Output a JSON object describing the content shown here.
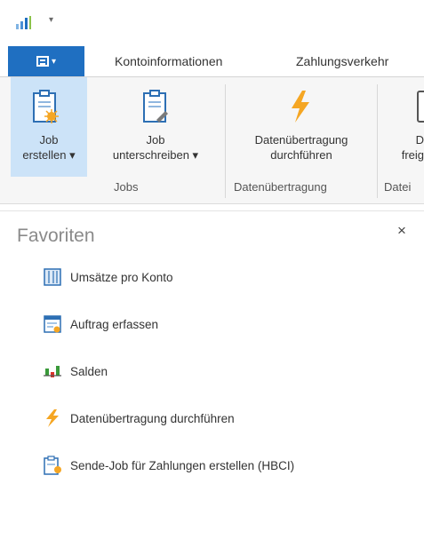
{
  "qat": {
    "dropdown_glyph": "▾"
  },
  "tabs": {
    "file_caret": "▾",
    "items": [
      {
        "label": "Kontoinformationen"
      },
      {
        "label": "Zahlungsverkehr"
      }
    ]
  },
  "ribbon": {
    "buttons": {
      "job_erstellen": {
        "line1": "Job",
        "line2": "erstellen ▾"
      },
      "job_unterschreiben": {
        "line1": "Job",
        "line2": "unterschreiben ▾"
      },
      "datenuebertragung": {
        "line1": "Datenübertragung",
        "line2": "durchführen"
      },
      "freigeben": {
        "line1": "D",
        "line2": "freig"
      }
    },
    "groups": {
      "jobs": "Jobs",
      "datenuebertragung": "Datenübertragung",
      "datei": "Datei"
    }
  },
  "panel": {
    "title": "Favoriten",
    "close_glyph": "×",
    "items": [
      {
        "label": "Umsätze pro Konto",
        "icon": "report-icon"
      },
      {
        "label": "Auftrag erfassen",
        "icon": "order-form-icon"
      },
      {
        "label": "Salden",
        "icon": "balance-chart-icon"
      },
      {
        "label": "Datenübertragung durchführen",
        "icon": "lightning-icon"
      },
      {
        "label": "Sende-Job für Zahlungen erstellen (HBCI)",
        "icon": "send-job-icon"
      }
    ]
  },
  "colors": {
    "accent": "#1f6fc1",
    "selected_button": "#cce3f8",
    "lightning": "#f5a623"
  }
}
